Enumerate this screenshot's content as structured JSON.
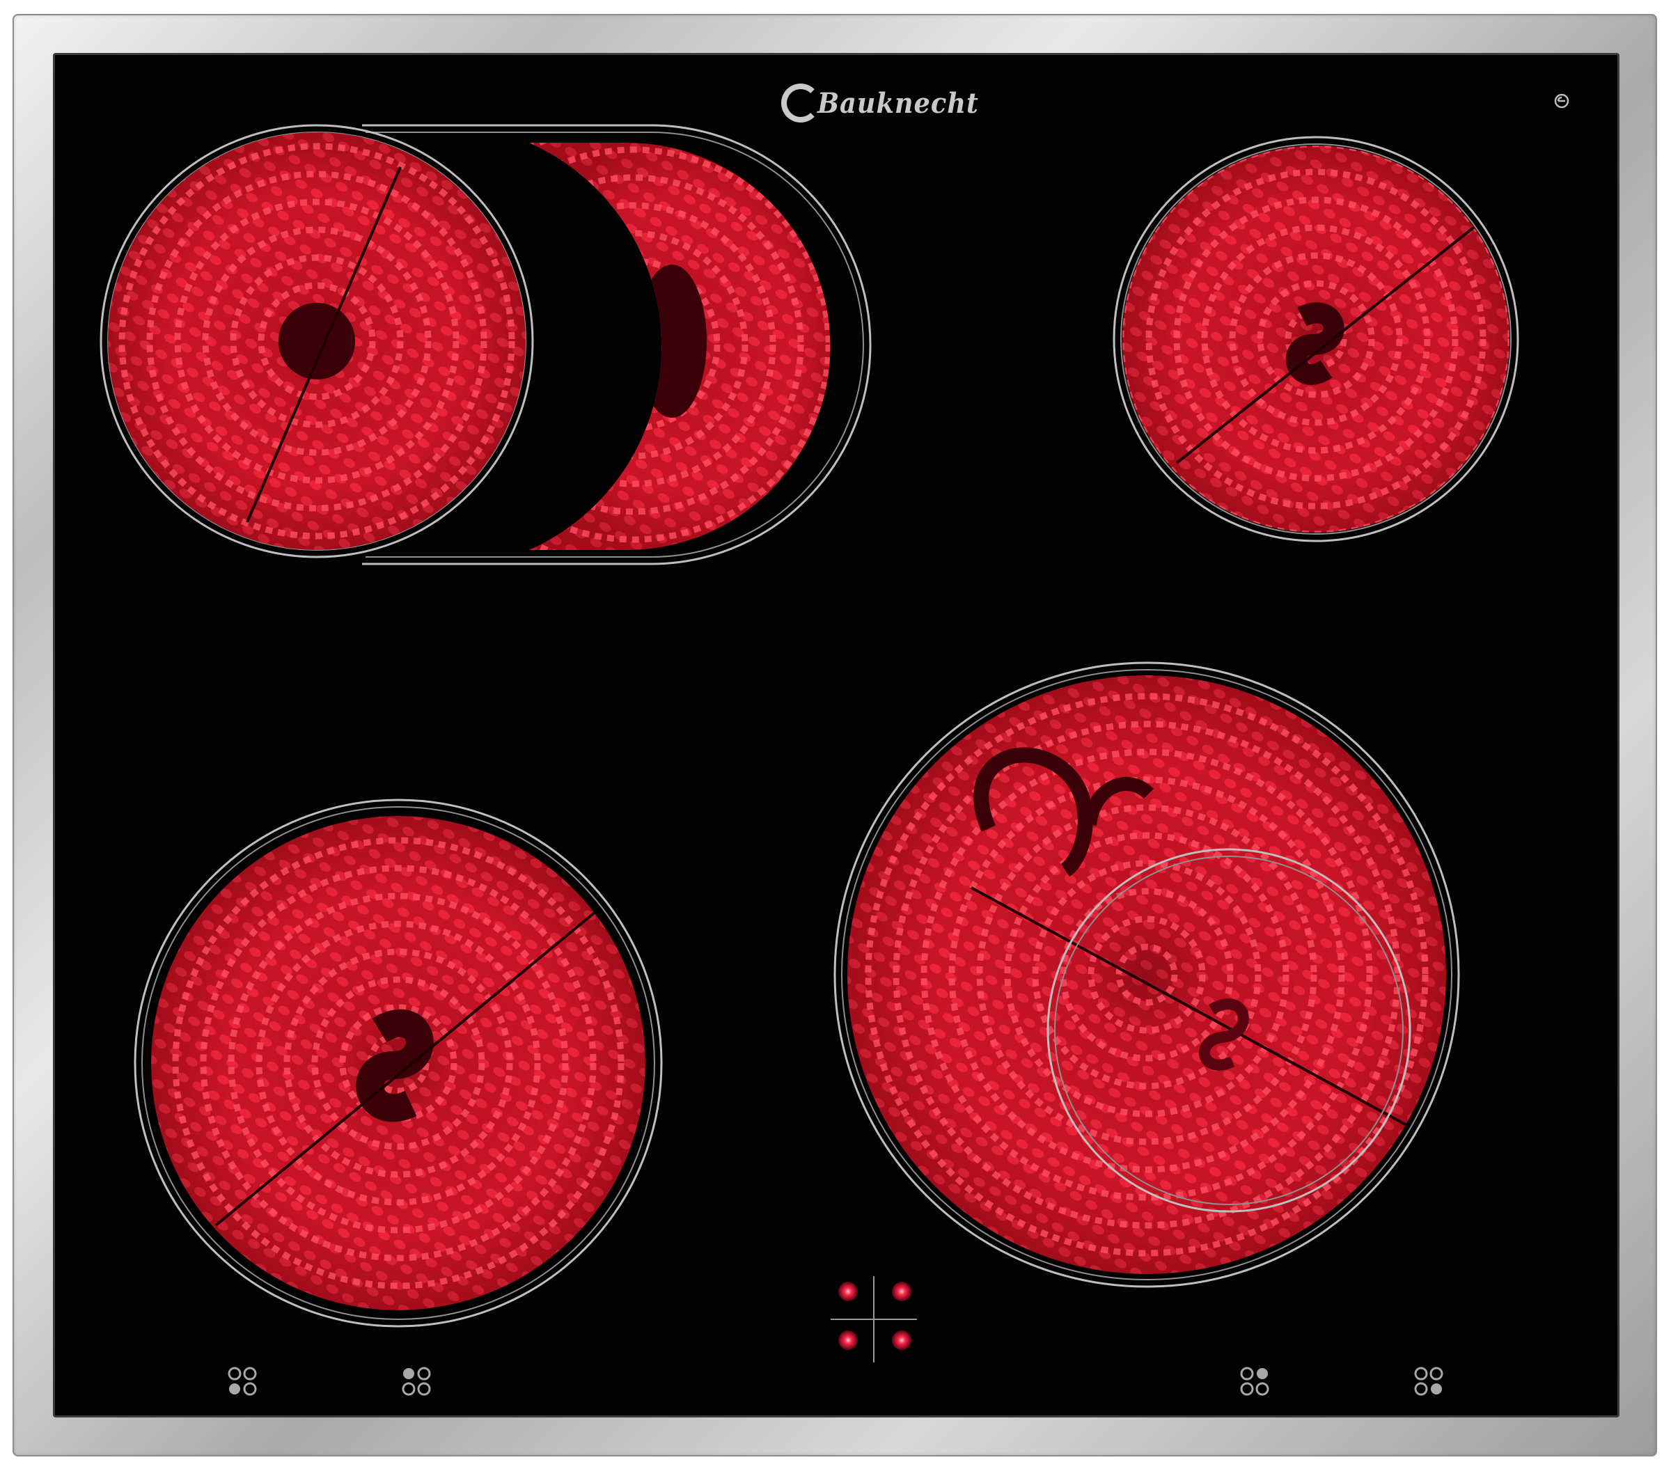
{
  "brand": {
    "name": "Bauknecht"
  },
  "appliance": {
    "frame_color": "#c4c4c4",
    "glass_color": "#020202",
    "glow_color": "#e0172a",
    "zone_ring_color": "#bfbfbf",
    "cooking_zones": [
      {
        "label": "dual-oval-zone",
        "position": "top-left",
        "state": "on"
      },
      {
        "label": "single-zone",
        "position": "top-right",
        "state": "on"
      },
      {
        "label": "single-zone",
        "position": "bottom-left",
        "state": "on"
      },
      {
        "label": "dual-circuit-zone",
        "position": "bottom-right",
        "state": "on"
      }
    ],
    "zone_selector_symbols": [
      {
        "position": "bottom-left-1",
        "highlighted": "bottom-left"
      },
      {
        "position": "bottom-left-2",
        "highlighted": "top-left"
      },
      {
        "position": "bottom-right-1",
        "highlighted": "top-right"
      },
      {
        "position": "bottom-right-2",
        "highlighted": "bottom-right"
      }
    ],
    "residual_heat_indicators": {
      "count": 4,
      "state": "lit",
      "color": "#ff2a4a"
    }
  }
}
